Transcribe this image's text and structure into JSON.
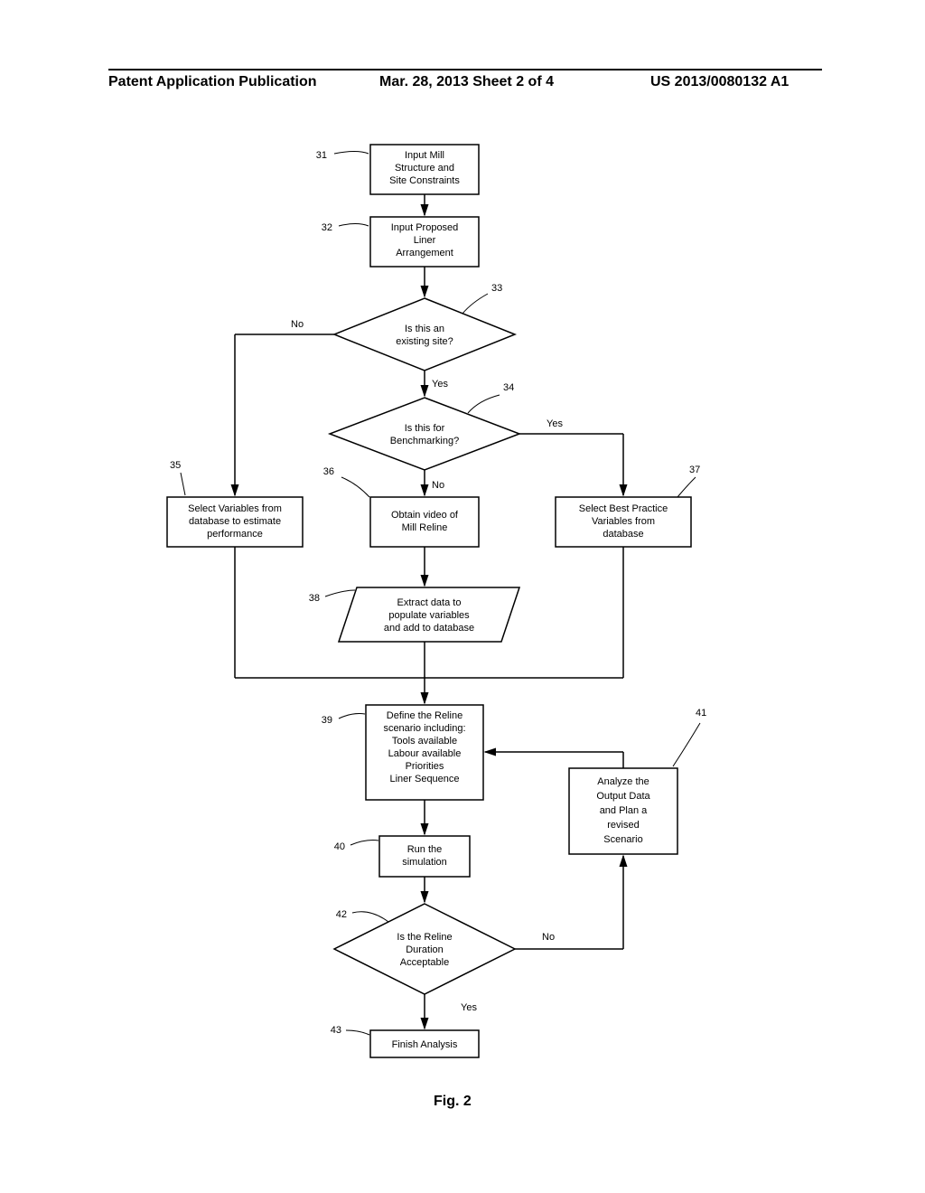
{
  "header": {
    "left": "Patent Application Publication",
    "mid": "Mar. 28, 2013  Sheet 2 of 4",
    "right": "US 2013/0080132 A1"
  },
  "figure_caption": "Fig. 2",
  "refs": {
    "r31": "31",
    "r32": "32",
    "r33": "33",
    "r34": "34",
    "r35": "35",
    "r36": "36",
    "r37": "37",
    "r38": "38",
    "r39": "39",
    "r40": "40",
    "r41": "41",
    "r42": "42",
    "r43": "43"
  },
  "edges": {
    "no": "No",
    "yes": "Yes"
  },
  "nodes": {
    "n31": {
      "l1": "Input Mill",
      "l2": "Structure and",
      "l3": "Site Constraints"
    },
    "n32": {
      "l1": "Input Proposed",
      "l2": "Liner",
      "l3": "Arrangement"
    },
    "n33": {
      "l1": "Is this an",
      "l2": "existing site?"
    },
    "n34": {
      "l1": "Is this for",
      "l2": "Benchmarking?"
    },
    "n35": {
      "l1": "Select Variables from",
      "l2": "database to estimate",
      "l3": "performance"
    },
    "n36": {
      "l1": "Obtain video of",
      "l2": "Mill Reline"
    },
    "n37": {
      "l1": "Select Best Practice",
      "l2": "Variables from",
      "l3": "database"
    },
    "n38": {
      "l1": "Extract data to",
      "l2": "populate variables",
      "l3": "and add to database"
    },
    "n39": {
      "l1": "Define the Reline",
      "l2": "scenario including:",
      "l3": "Tools available",
      "l4": "Labour available",
      "l5": "Priorities",
      "l6": "Liner Sequence"
    },
    "n40": {
      "l1": "Run the",
      "l2": "simulation"
    },
    "n41": {
      "l1": "Analyze the",
      "l2": "Output Data",
      "l3": "and Plan a",
      "l4": "revised",
      "l5": "Scenario"
    },
    "n42": {
      "l1": "Is the Reline",
      "l2": "Duration",
      "l3": "Acceptable"
    },
    "n43": {
      "l1": "Finish Analysis"
    }
  }
}
